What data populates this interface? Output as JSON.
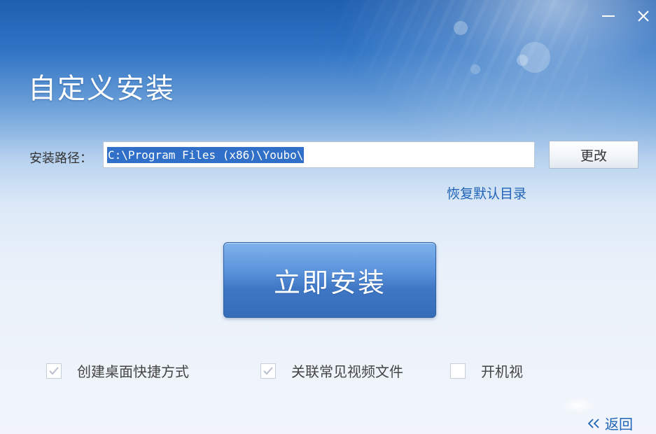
{
  "window": {
    "title": "自定义安装",
    "controls": {
      "minimize_icon": "minimize-icon",
      "close_icon": "close-icon"
    }
  },
  "install_path": {
    "label": "安装路径：",
    "value": "C:\\Program Files (x86)\\Youbo\\",
    "change_button": "更改",
    "restore_link": "恢复默认目录"
  },
  "install_button": "立即安装",
  "options": [
    {
      "label": "创建桌面快捷方式",
      "checked": true
    },
    {
      "label": "关联常见视频文件",
      "checked": true
    },
    {
      "label": "开机视",
      "checked": false
    }
  ],
  "back_link": {
    "label": "返回",
    "icon": "double-chevron-left-icon"
  },
  "colors": {
    "accent": "#1f63b8",
    "header_blue": "#1f5fb0",
    "button_blue": "#3f77c5",
    "selection": "#3170c8"
  }
}
